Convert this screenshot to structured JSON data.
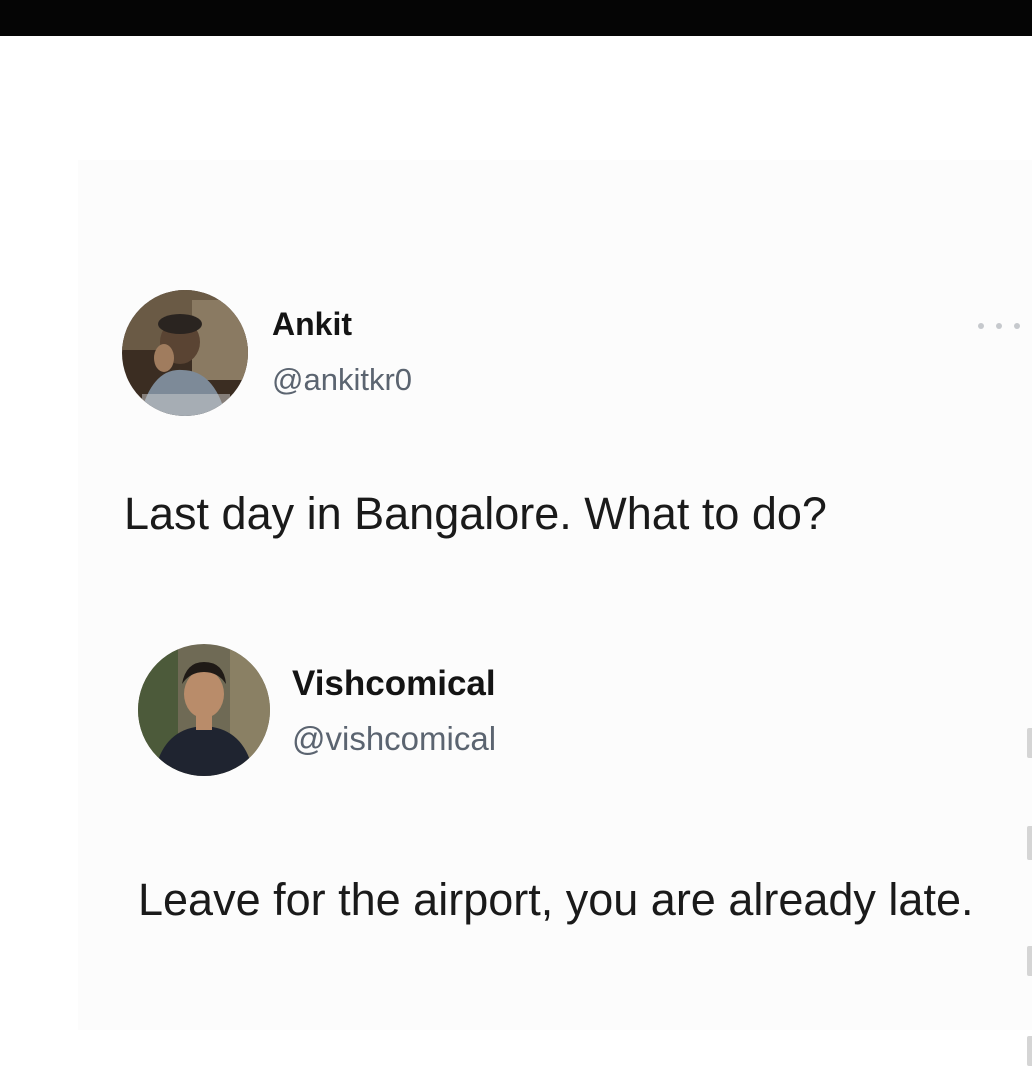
{
  "tweets": [
    {
      "display_name": "Ankit",
      "handle": "@ankitkr0",
      "text": "Last day in Bangalore. What to do?",
      "avatar_icon": "user-photo-avatar"
    },
    {
      "display_name": "Vishcomical",
      "handle": "@vishcomical",
      "text": "Leave for the airport, you are already late.",
      "avatar_icon": "user-photo-avatar"
    }
  ],
  "colors": {
    "top_bar": "#050505",
    "name_text": "#141414",
    "handle_text": "#5b6470",
    "body_text": "#1a1a1a",
    "more_dots": "#c6c9cd"
  }
}
